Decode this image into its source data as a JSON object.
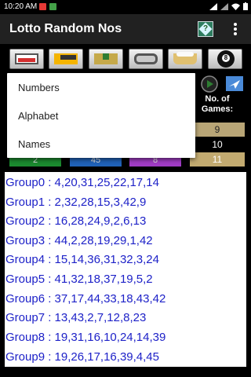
{
  "status": {
    "time": "10:20 AM"
  },
  "appbar": {
    "title": "Lotto Random Nos"
  },
  "dropdown": {
    "items": [
      "Numbers",
      "Alphabet",
      "Names"
    ]
  },
  "games": {
    "label_line1": "No. of",
    "label_line2": "Games:",
    "options": [
      "9",
      "10",
      "11"
    ]
  },
  "color_buttons": [
    {
      "label": "2",
      "color": "#1b8a2f"
    },
    {
      "label": "45",
      "color": "#2062b8"
    },
    {
      "label": "8",
      "color": "#a03cc4"
    }
  ],
  "results": [
    "Group0 : 4,20,31,25,22,17,14",
    "Group1 : 2,32,28,15,3,42,9",
    "Group2 : 16,28,24,9,2,6,13",
    "Group3 : 44,2,28,19,29,1,42",
    "Group4 : 15,14,36,31,32,3,24",
    "Group5 : 41,32,18,37,19,5,2",
    "Group6 : 37,17,44,33,18,43,42",
    "Group7 : 13,43,2,7,12,8,23",
    "Group8 : 19,31,16,10,24,14,39",
    "Group9 : 19,26,17,16,39,4,45"
  ],
  "icons": {
    "help": "help-icon",
    "overflow": "overflow-menu-icon",
    "tools": [
      "lotto-ticket-icon",
      "folder-icon",
      "download-icon",
      "chain-icon",
      "basket-icon",
      "eight-ball-icon"
    ],
    "play": "play-icon",
    "send": "send-icon"
  }
}
